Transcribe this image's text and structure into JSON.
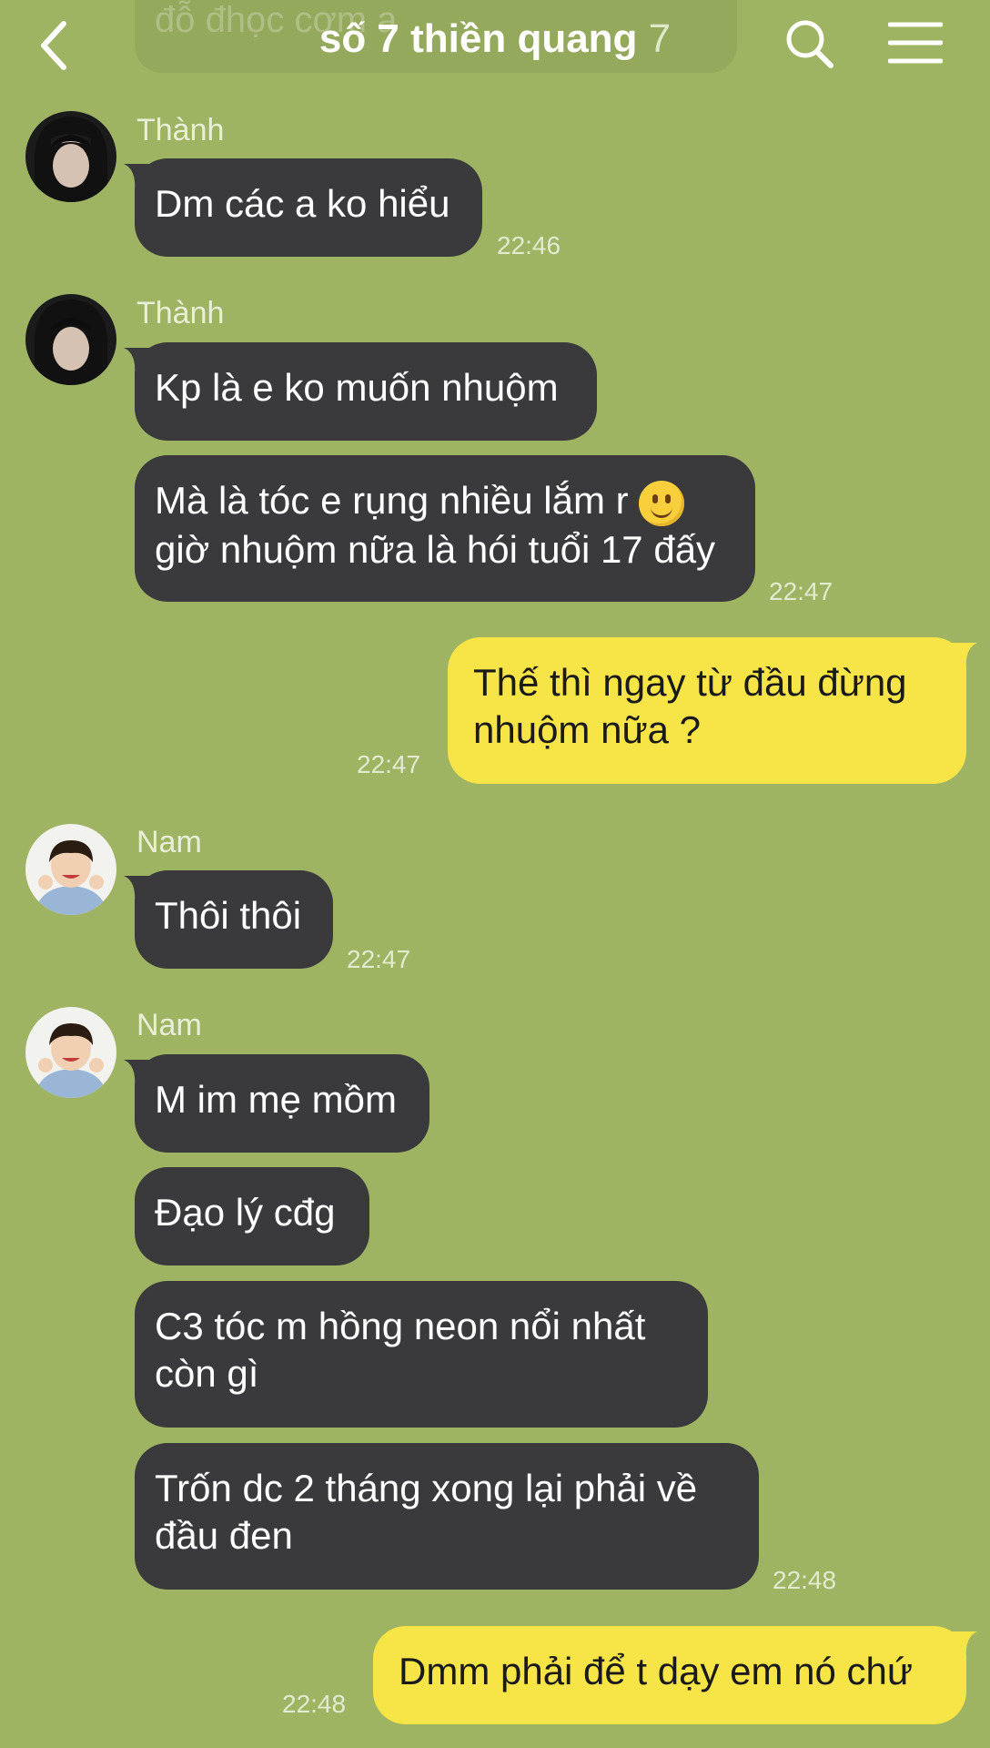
{
  "header": {
    "ghost_text": "đỗ đhọc cơm a",
    "title": "số 7 thiền quang",
    "member_count": "7"
  },
  "messages": [
    {
      "sender": "Thành",
      "text": "Dm các a ko hiểu",
      "time": "22:46"
    },
    {
      "sender": "Thành",
      "text": "Kp là e ko muốn nhuộm"
    },
    {
      "text_line1": "Mà là tóc e rụng nhiều lắm r",
      "text_line2": "giờ nhuộm nữa là hói tuổi 17 đấy",
      "time": "22:47"
    },
    {
      "text_line1": "Thế thì ngay từ đầu đừng",
      "text_line2": "nhuộm nữa ?",
      "time": "22:47"
    },
    {
      "sender": "Nam",
      "text": "Thôi thôi",
      "time": "22:47"
    },
    {
      "sender": "Nam",
      "text": "M im mẹ mồm"
    },
    {
      "text": "Đạo lý cđg"
    },
    {
      "text_line1": "C3 tóc m hồng neon nổi nhất",
      "text_line2": "còn gì"
    },
    {
      "text_line1": "Trốn dc 2 tháng xong lại phải về",
      "text_line2": "đầu đen",
      "time": "22:48"
    },
    {
      "text": "Dmm phải để t dạy em nó chứ",
      "time": "22:48"
    }
  ],
  "colors": {
    "background": "#9fb463",
    "incoming_bubble": "#3a3a3c",
    "outgoing_bubble": "#f7e447"
  }
}
